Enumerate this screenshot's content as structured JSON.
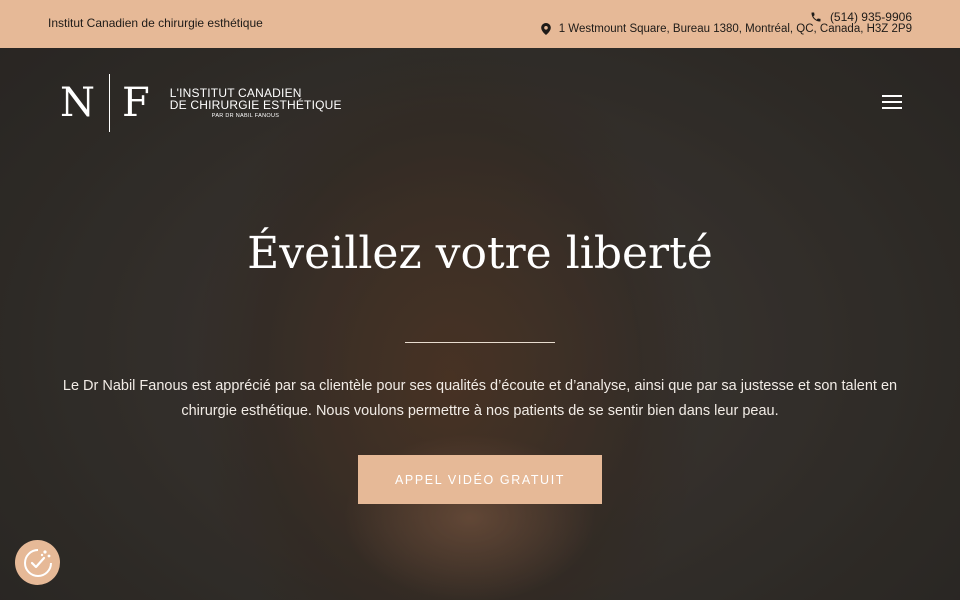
{
  "topbar": {
    "brand": "Institut Canadien de chirurgie esthétique",
    "phone": "(514) 935-9906",
    "address": "1 Westmount Square, Bureau 1380, Montréal, QC, Canada, H3Z 2P9",
    "phone_icon": "phone-icon",
    "location_icon": "map-pin-icon"
  },
  "logo": {
    "letter_left": "N",
    "letter_right": "F",
    "line1": "L'INSTITUT CANADIEN",
    "line2": "DE CHIRURGIE ESTHÉTIQUE",
    "line3": "PAR DR NABIL FANOUS"
  },
  "menu": {
    "icon": "hamburger-menu-icon"
  },
  "hero": {
    "title": "Éveillez votre liberté",
    "lead": "Le Dr Nabil Fanous est apprécié par sa clientèle pour ses qualités d’écoute et d’analyse, ainsi que par sa justesse et son talent en chirurgie esthétique. Nous voulons permettre à nos patients de se sentir bien dans leur peau.",
    "cta_label": "APPEL VIDÉO GRATUIT"
  },
  "cookie": {
    "icon": "cookie-consent-icon"
  },
  "colors": {
    "accent": "#e6b997",
    "dark_text": "#1e1b18"
  }
}
